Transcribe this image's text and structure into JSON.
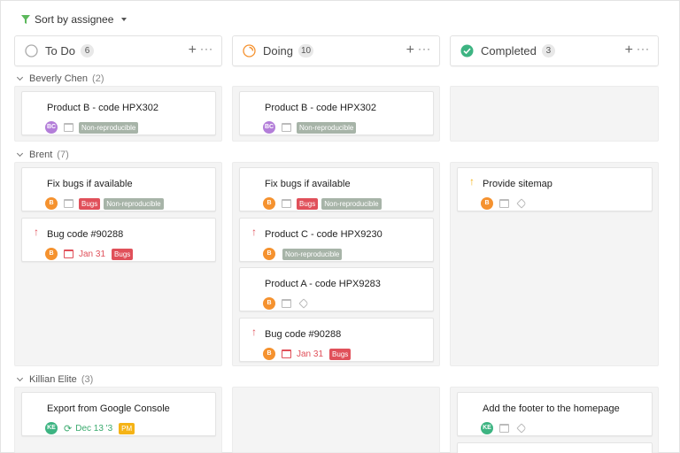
{
  "toolbar": {
    "sort_label": "Sort by assignee",
    "icon": "funnel-icon"
  },
  "colors": {
    "avatar_purple": "#b37ed9",
    "avatar_orange": "#f5922f",
    "avatar_green": "#3db482",
    "tag_gray": "#a7b4a8",
    "tag_red": "#e0505a",
    "tag_yellow": "#f5b316",
    "arrow_red": "#e0505a",
    "arrow_yellow": "#f5b316"
  },
  "columns": [
    {
      "title": "To Do",
      "count": "6"
    },
    {
      "title": "Doing",
      "count": "10"
    },
    {
      "title": "Completed",
      "count": "3"
    }
  ],
  "column_actions": {
    "plus": "+",
    "more": "···"
  },
  "groups": [
    {
      "name": "Beverly Chen",
      "count": "(2)"
    },
    {
      "name": "Brent",
      "count": "(7)"
    },
    {
      "name": "Killian Elite",
      "count": "(3)"
    }
  ],
  "cards": {
    "c1": {
      "title": "Product B - code HPX302",
      "avatar": "BC",
      "tag1": "Non-reproducible"
    },
    "c2": {
      "title": "Product B - code HPX302",
      "avatar": "BC",
      "tag1": "Non-reproducible"
    },
    "c3": {
      "title": "Fix bugs if available",
      "avatar": "B",
      "tag1": "Bugs",
      "tag2": "Non-reproducible"
    },
    "c4": {
      "title": "Bug code #90288",
      "avatar": "B",
      "arrow": "↑",
      "due": "Jan 31",
      "tag1": "Bugs"
    },
    "c5": {
      "title": "Fix bugs if available",
      "avatar": "B",
      "tag1": "Bugs",
      "tag2": "Non-reproducible"
    },
    "c6": {
      "title": "Product C - code HPX9230",
      "avatar": "B",
      "arrow": "↑",
      "tag1": "Non-reproducible"
    },
    "c7": {
      "title": "Product A - code HPX9283",
      "avatar": "B"
    },
    "c8": {
      "title": "Bug code #90288",
      "avatar": "B",
      "arrow": "↑",
      "due": "Jan 31",
      "tag1": "Bugs"
    },
    "c9": {
      "title": "Provide sitemap",
      "avatar": "B",
      "arrow": "↑"
    },
    "c10": {
      "title": "Export from Google Console",
      "avatar": "KE",
      "repeat": "⟳",
      "due": "Dec 13 '3",
      "tag1": "PM"
    },
    "c11": {
      "title": "Add the footer to the homepage",
      "avatar": "KE"
    }
  }
}
